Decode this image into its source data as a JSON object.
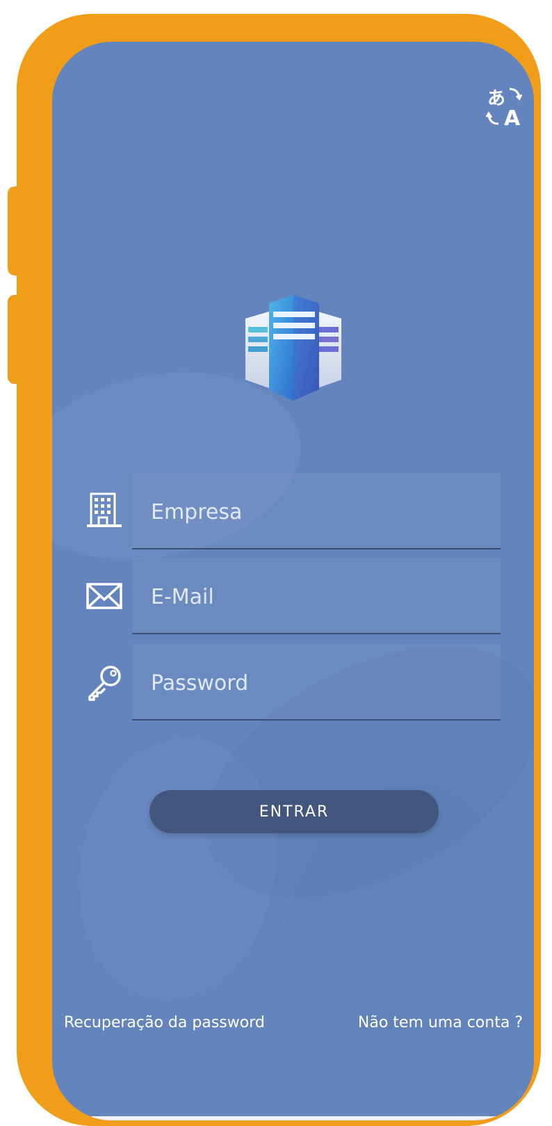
{
  "colors": {
    "frame": "#f09e1a",
    "background": "#6484bd",
    "button": "#43567e",
    "text": "#ffffff"
  },
  "header": {
    "language_icon": "translate-icon"
  },
  "logo": {
    "icon": "building-logo-icon"
  },
  "form": {
    "company": {
      "placeholder": "Empresa",
      "value": "",
      "icon": "building-icon"
    },
    "email": {
      "placeholder": "E-Mail",
      "value": "",
      "icon": "envelope-icon"
    },
    "password": {
      "placeholder": "Password",
      "value": "",
      "icon": "key-icon"
    },
    "submit_label": "ENTRAR"
  },
  "footer": {
    "recover_label": "Recuperação da password",
    "signup_label": "Não tem uma conta ?"
  }
}
